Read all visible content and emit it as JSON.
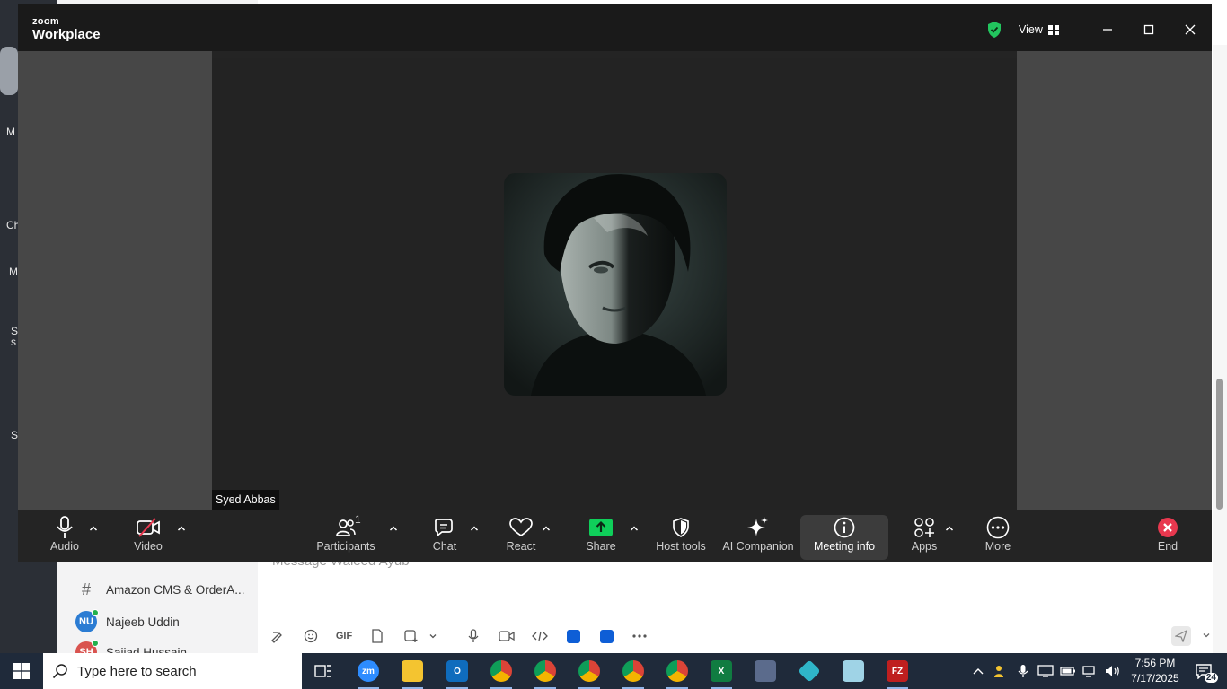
{
  "background_app": {
    "rail_fragments": [
      "M",
      "Ch",
      "M",
      "S",
      "s",
      "S"
    ],
    "sidebar": {
      "items": [
        {
          "type": "channel",
          "label": "Amazon CMS & OrderA..."
        },
        {
          "type": "dm",
          "initials": "NU",
          "label": "Najeeb Uddin"
        },
        {
          "type": "dm",
          "initials": "SH",
          "label": "Sajjad Hussain"
        }
      ]
    },
    "message_placeholder": "Message Waleed Ayub",
    "composer_tools": [
      "format-icon",
      "emoji-icon",
      "GIF",
      "file-icon",
      "screenshot-icon",
      "chevron-down-icon",
      "mic-icon",
      "video-clip-icon",
      "code-icon",
      "app1-icon",
      "app2-icon",
      "more-icon"
    ]
  },
  "zoom": {
    "logo_line1": "zoom",
    "logo_line2": "Workplace",
    "view_label": "View",
    "participant_name": "Syed Abbas",
    "participant_count": "1",
    "toolbar": {
      "audio": "Audio",
      "video": "Video",
      "participants": "Participants",
      "chat": "Chat",
      "react": "React",
      "share": "Share",
      "host_tools": "Host tools",
      "ai_companion": "AI Companion",
      "meeting_info": "Meeting info",
      "apps": "Apps",
      "more": "More",
      "end": "End"
    },
    "colors": {
      "share_green": "#0fcf5a",
      "end_red": "#e8384f",
      "shield_green": "#22c55e"
    }
  },
  "taskbar": {
    "search_placeholder": "Type here to search",
    "time": "7:56 PM",
    "date": "7/17/2025",
    "notification_count": "24",
    "apps": [
      "task-view",
      "zoom",
      "file-explorer",
      "outlook",
      "chrome",
      "chrome",
      "chrome",
      "chrome",
      "chrome",
      "excel",
      "calculator",
      "app",
      "app",
      "filezilla"
    ]
  }
}
